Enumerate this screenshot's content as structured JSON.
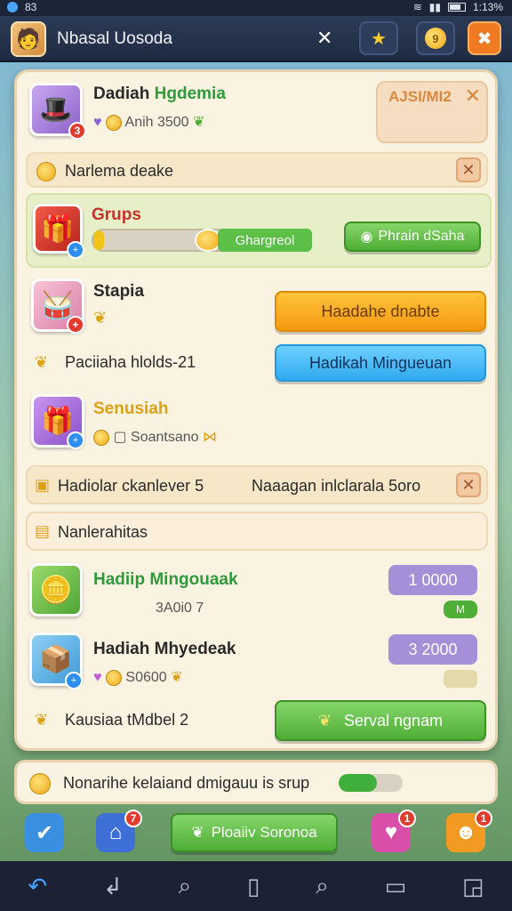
{
  "status": {
    "left_text": "83",
    "right_text": "1:13%"
  },
  "topbar": {
    "title": "Nbasal Uosoda",
    "close_label": "✕",
    "coin_label": "9"
  },
  "profile": {
    "name_part1": "Dadiah",
    "name_part2": "Hgdemia",
    "amount": "Anih 3500",
    "badge": "3",
    "panel_tag": "AJSI/MI2"
  },
  "notice": {
    "text": "Narlema deake"
  },
  "grups": {
    "title": "Grups",
    "progress_label": "Ghargreol",
    "progress": 0.05,
    "button": "Phrain dSaha"
  },
  "stapia": {
    "title": "Stapia",
    "button_orange": "Haadahe dnabte",
    "button_blue": "Hadikah Mingueuan",
    "sub": "Paciiaha hlolds-21"
  },
  "senusiah": {
    "title": "Senusiah",
    "sub": "Soantsano"
  },
  "row_hadiolar": {
    "left": "Hadiolar ckanlever 5",
    "right": "Naaagan inlclarala 5oro"
  },
  "row_nanlera": {
    "text": "Nanlerahitas"
  },
  "hadiip": {
    "title": "Hadiip Mingouaak",
    "sub": "3A0i0 7",
    "pill": "1 0000",
    "tag": "M"
  },
  "hadiah": {
    "title": "Hadiah Mhyedeak",
    "sub": "S0600",
    "pill": "3 2000"
  },
  "kausiaa": {
    "text": "Kausiaa tMdbel 2",
    "button": "Serval ngnam"
  },
  "footer": {
    "text": "Nonarihe kelaiand dmigauu is srup",
    "progress": 0.6
  },
  "tabs": {
    "center_label": "Ploaiiv Soronoa",
    "badge_star": "7",
    "badge_gift": "1",
    "badge_pet": "1"
  },
  "colors": {
    "accent_green": "#4eae35",
    "accent_orange": "#f59a12",
    "accent_blue": "#2fa9f0",
    "pill_purple": "#a48fd8"
  }
}
